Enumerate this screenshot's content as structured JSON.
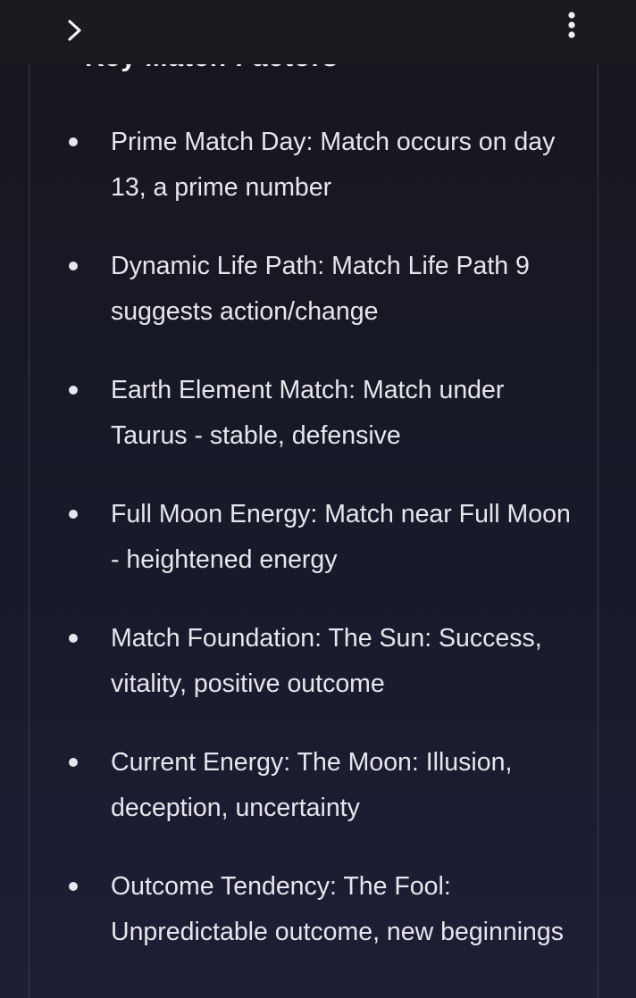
{
  "toolbar": {
    "expand_icon": "chevron-right-icon",
    "menu_icon": "more-vertical-icon"
  },
  "section": {
    "heading": "Key Match Factors"
  },
  "facts": [
    {
      "text": "Prime Match Day: Match occurs on day 13, a prime number"
    },
    {
      "text": "Dynamic Life Path: Match Life Path 9 suggests action/change"
    },
    {
      "text": "Earth Element Match: Match under Taurus - stable, defensive"
    },
    {
      "text": "Full Moon Energy: Match near Full Moon - heightened energy"
    },
    {
      "text": "Match Foundation: The Sun: Success, vitality, positive outcome"
    },
    {
      "text": "Current Energy: The Moon: Illusion, deception, uncertainty"
    },
    {
      "text": "Outcome Tendency: The Fool: Unpredictable outcome, new beginnings"
    }
  ]
}
